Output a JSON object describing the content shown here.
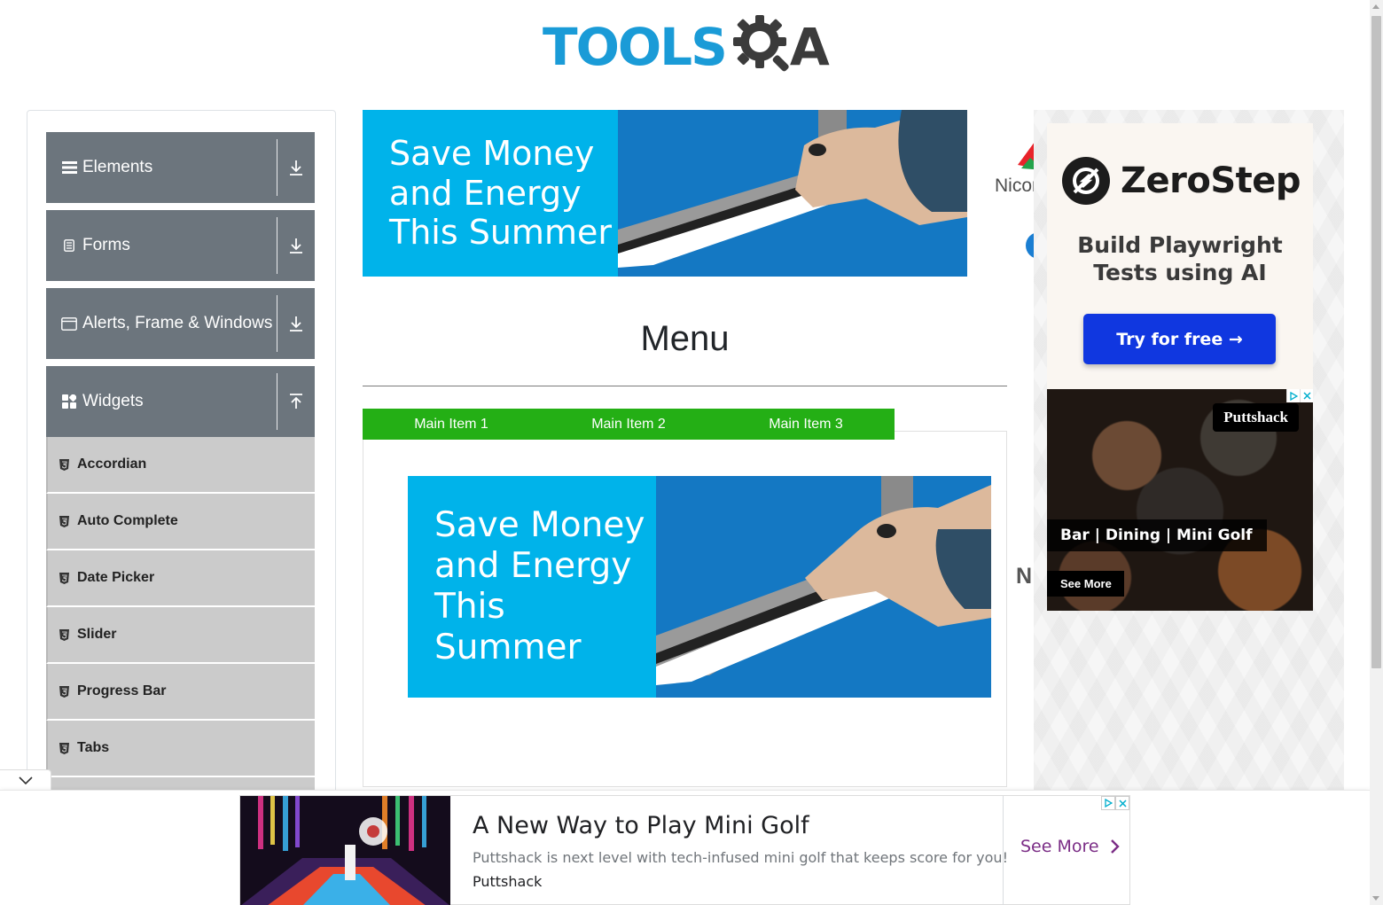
{
  "header": {
    "logo_text": "TOOLS",
    "logo_suffix": "A"
  },
  "sidebar": {
    "groups": [
      {
        "label": "Elements",
        "icon": "list-icon",
        "state": "collapsed"
      },
      {
        "label": "Forms",
        "icon": "document-icon",
        "state": "collapsed"
      },
      {
        "label": "Alerts, Frame & Windows",
        "icon": "window-icon",
        "state": "collapsed"
      },
      {
        "label": "Widgets",
        "icon": "widgets-icon",
        "state": "expanded"
      }
    ],
    "items": [
      {
        "label": "Accordian"
      },
      {
        "label": "Auto Complete"
      },
      {
        "label": "Date Picker"
      },
      {
        "label": "Slider"
      },
      {
        "label": "Progress Bar"
      },
      {
        "label": "Tabs"
      }
    ]
  },
  "banner": {
    "lines": [
      "Save Money",
      "and Energy",
      "This Summer"
    ]
  },
  "main": {
    "heading": "Menu",
    "nav_items": [
      "Main Item 1",
      "Main Item 2",
      "Main Item 3"
    ],
    "nav_color": "#24af15"
  },
  "right_peek": {
    "nicon_text": "Nicor",
    "n_text": "N"
  },
  "zerostep_ad": {
    "brand": "ZeroStep",
    "tagline_1": "Build Playwright",
    "tagline_2": "Tests using AI",
    "cta": "Try for free →",
    "cta_color": "#1037e0"
  },
  "puttshack_ad": {
    "brand": "Puttshack",
    "tagline": "Bar | Dining | Mini Golf",
    "cta": "See More"
  },
  "bottom_ad": {
    "title": "A New Way to Play Mini Golf",
    "description": "Puttshack is next level with tech-infused mini golf that keeps score for you!",
    "brand": "Puttshack",
    "cta": "See More"
  },
  "colors": {
    "sidebar_header": "#6c757d",
    "sidebar_item": "#cbcbcb",
    "banner_cyan": "#00b3ea",
    "banner_blue": "#1478c3",
    "brand_blue": "#1a9bd7"
  }
}
